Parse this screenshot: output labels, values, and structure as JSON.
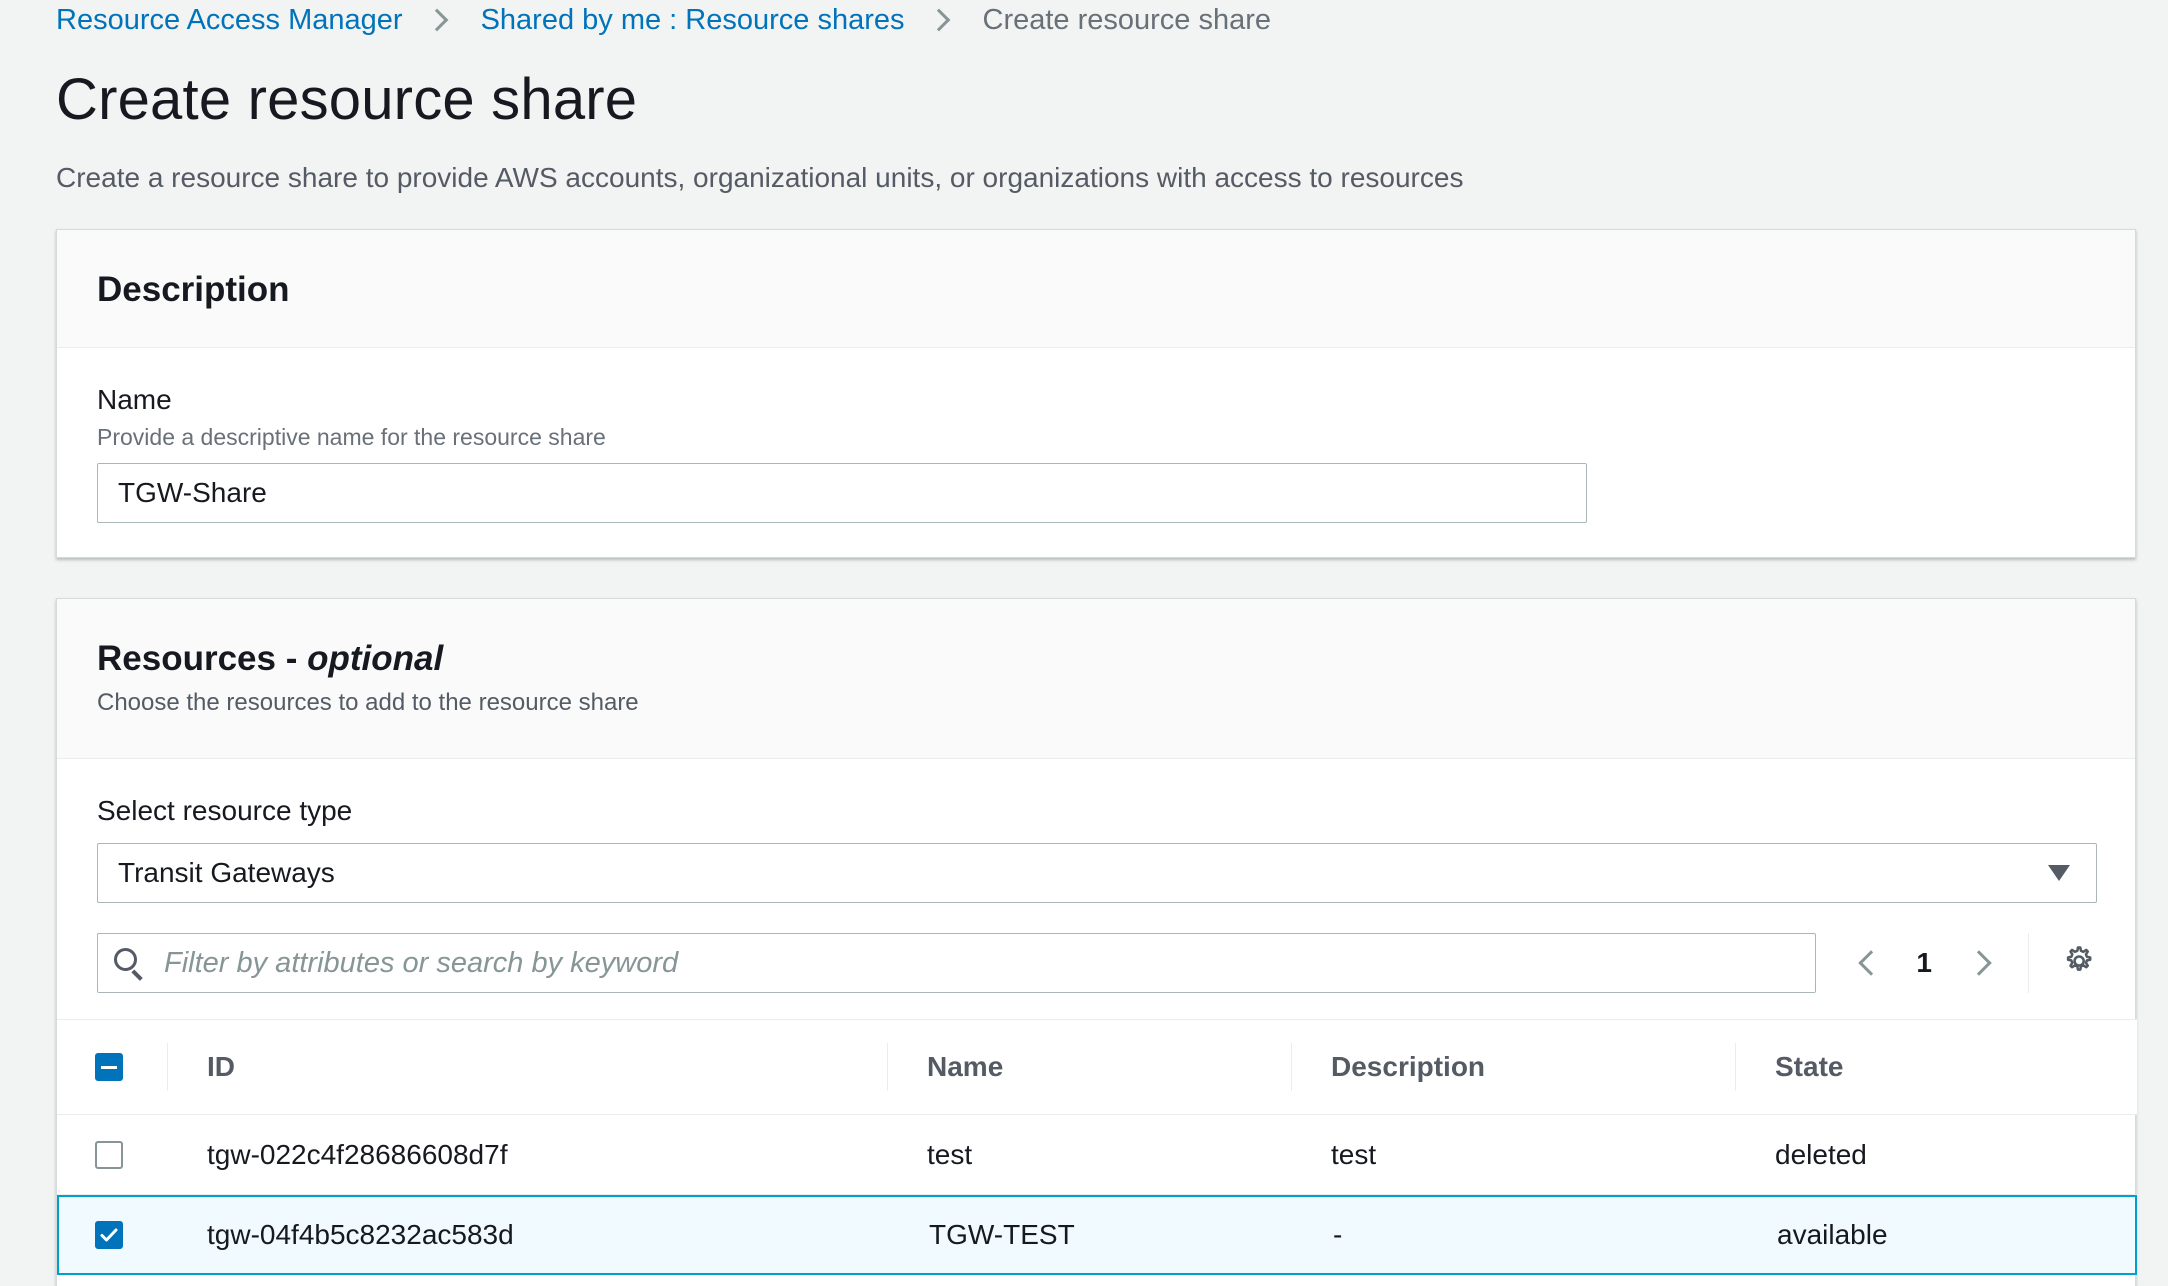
{
  "breadcrumb": {
    "items": [
      "Resource Access Manager",
      "Shared by me : Resource shares"
    ],
    "current": "Create resource share"
  },
  "header": {
    "title": "Create resource share",
    "description": "Create a resource share to provide AWS accounts, organizational units, or organizations with access to resources"
  },
  "description_panel": {
    "title": "Description",
    "name_label": "Name",
    "name_hint": "Provide a descriptive name for the resource share",
    "name_value": "TGW-Share"
  },
  "resources_panel": {
    "title": "Resources - ",
    "title_optional": "optional",
    "subtitle": "Choose the resources to add to the resource share",
    "type_label": "Select resource type",
    "type_value": "Transit Gateways",
    "filter_placeholder": "Filter by attributes or search by keyword",
    "page": "1",
    "columns": [
      "ID",
      "Name",
      "Description",
      "State"
    ],
    "rows": [
      {
        "id": "tgw-022c4f28686608d7f",
        "name": "test",
        "description": "test",
        "state": "deleted",
        "checked": false
      },
      {
        "id": "tgw-04f4b5c8232ac583d",
        "name": "TGW-TEST",
        "description": "-",
        "state": "available",
        "checked": true
      }
    ]
  },
  "colors": {
    "link": "#0073bb",
    "selected_border": "#00a1c9",
    "selected_bg": "#f1faff",
    "background": "#f2f3f3"
  }
}
